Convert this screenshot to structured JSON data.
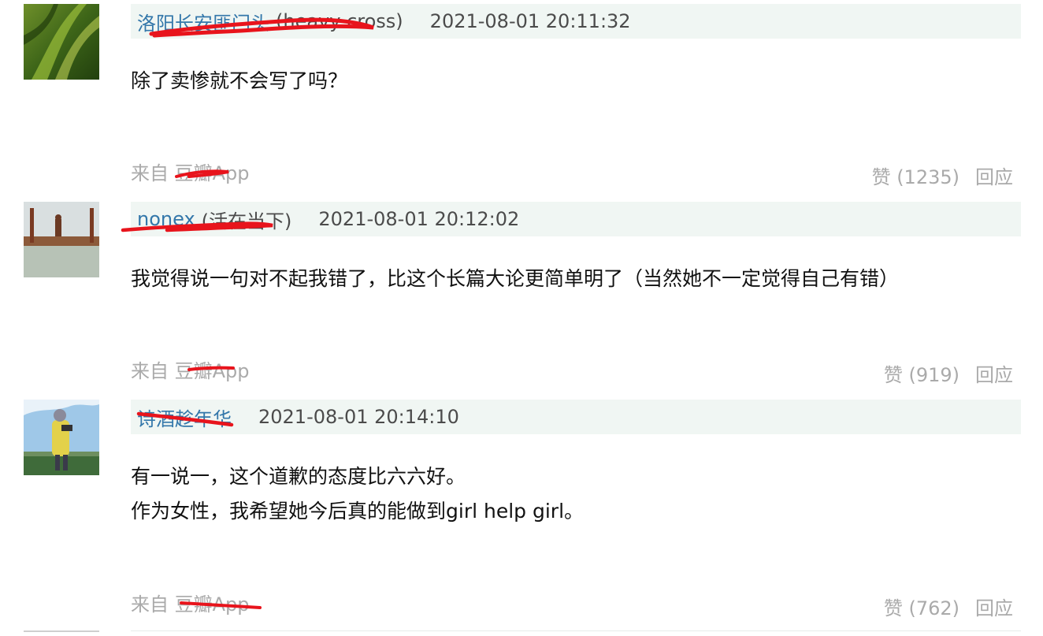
{
  "comments": [
    {
      "author": "洛阳长安匪门头",
      "author_extra": "(heavy cross)",
      "time": "2021-08-01 20:11:32",
      "lines": [
        "除了卖惨就不会写了吗？"
      ],
      "source": "来自 豆瓣App",
      "like": "赞 (1235)",
      "reply": "回应"
    },
    {
      "author": "nonex",
      "author_extra": "(活在当下)",
      "time": "2021-08-01 20:12:02",
      "lines": [
        "我觉得说一句对不起我错了，比这个长篇大论更简单明了（当然她不一定觉得自己有错）"
      ],
      "source": "来自 豆瓣App",
      "like": "赞 (919)",
      "reply": "回应"
    },
    {
      "author": "诗酒趁年华",
      "author_extra": "",
      "time": "2021-08-01 20:14:10",
      "lines": [
        "有一说一，这个道歉的态度比六六好。",
        "作为女性，我希望她今后真的能做到girl help girl。"
      ],
      "source": "来自 豆瓣App",
      "like": "赞 (762)",
      "reply": "回应"
    }
  ],
  "colors": {
    "link": "#3377aa",
    "header_bg": "#f0f6f3",
    "meta": "#aaaaaa",
    "scribble": "#e8141c"
  },
  "icons": [
    "avatar-leaf",
    "avatar-landscape",
    "avatar-photographer"
  ]
}
